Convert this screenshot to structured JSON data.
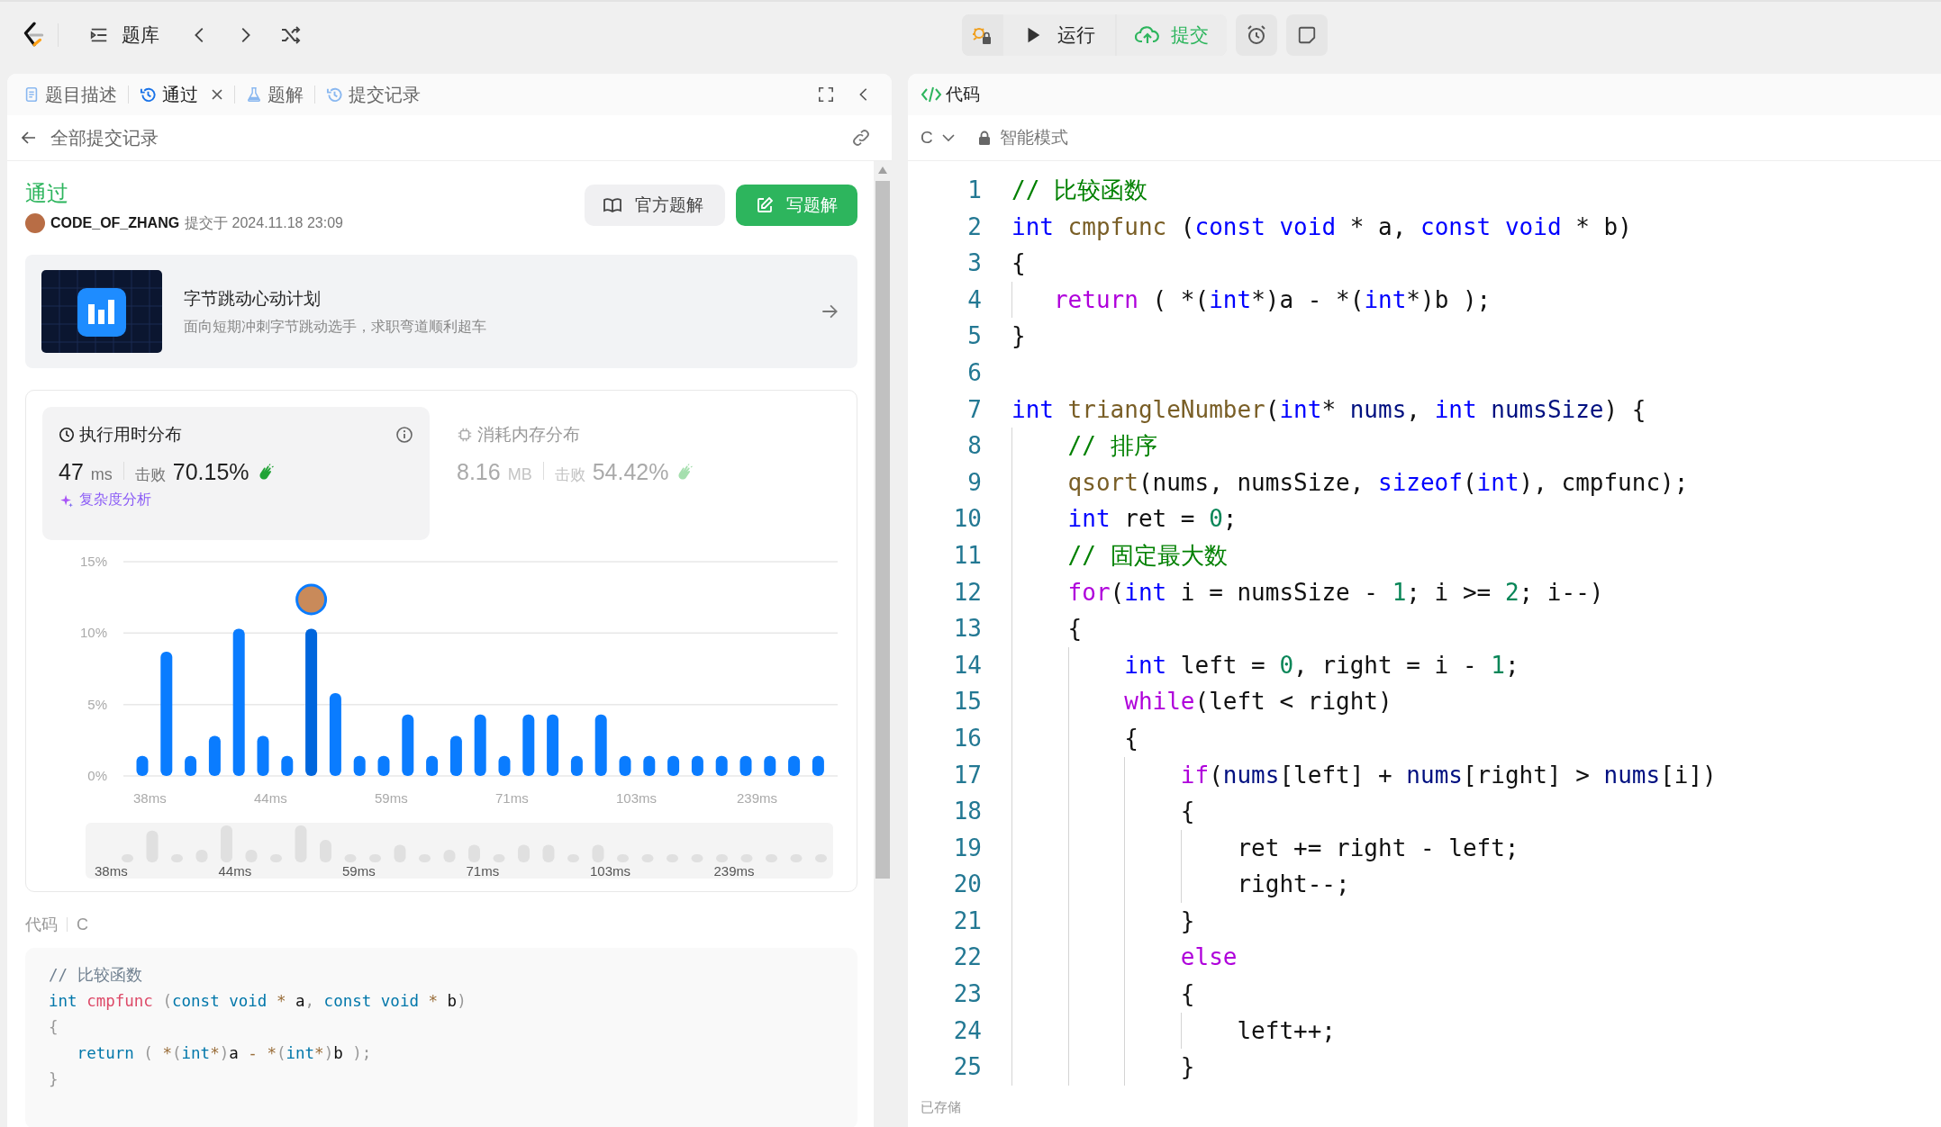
{
  "top_bar": {
    "problem_bank": "题库",
    "run": "运行",
    "submit": "提交"
  },
  "left_tabs": [
    {
      "label": "题目描述",
      "kind": "doc",
      "selected": false,
      "closable": false
    },
    {
      "label": "通过",
      "kind": "history",
      "selected": true,
      "closable": true
    },
    {
      "label": "题解",
      "kind": "flask",
      "selected": false,
      "closable": false
    },
    {
      "label": "提交记录",
      "kind": "history",
      "selected": false,
      "closable": false
    }
  ],
  "back": "全部提交记录",
  "submission": {
    "status": "通过",
    "user": "CODE_OF_ZHANG",
    "submitted_at": "提交于 2024.11.18 23:09",
    "buttons": [
      {
        "label": "官方题解",
        "kind": "secondary"
      },
      {
        "label": "写题解",
        "kind": "primary"
      }
    ]
  },
  "banner": {
    "title": "字节跳动心动计划",
    "subtitle": "面向短期冲刺字节跳动选手，求职弯道顺利超车"
  },
  "stats": [
    {
      "kind": "time",
      "title": "执行用时分布",
      "value": "47",
      "unit": "ms",
      "beat_label": "击败",
      "beat": "70.15%",
      "selected": true,
      "link": "复杂度分析"
    },
    {
      "kind": "memory",
      "title": "消耗内存分布",
      "value": "8.16",
      "unit": "MB",
      "beat_label": "击败",
      "beat": "54.42%",
      "selected": false
    }
  ],
  "chart_data": {
    "type": "bar",
    "categories": [
      "38ms",
      null,
      null,
      null,
      null,
      "44ms",
      null,
      null,
      null,
      null,
      "59ms",
      null,
      null,
      null,
      null,
      "71ms",
      null,
      null,
      null,
      null,
      "103ms",
      null,
      null,
      null,
      null,
      "239ms",
      null,
      null,
      null
    ],
    "values": [
      1.4,
      8.7,
      1.4,
      2.8,
      10.3,
      2.8,
      1.4,
      10.3,
      5.8,
      1.4,
      1.4,
      4.3,
      1.4,
      2.8,
      4.3,
      1.4,
      4.3,
      4.3,
      1.4,
      4.3,
      1.4,
      1.4,
      1.4,
      1.4,
      1.4,
      1.4,
      1.4,
      1.4,
      1.4
    ],
    "ylim": [
      0,
      15
    ],
    "yticks": [
      {
        "value": 0,
        "label": "0%"
      },
      {
        "value": 5,
        "label": "5%"
      },
      {
        "value": 10,
        "label": "10%"
      },
      {
        "value": 15,
        "label": "15%"
      }
    ]
  },
  "bar_states": [
    {
      "selected": false
    },
    {
      "selected": false
    },
    {
      "selected": false
    },
    {
      "selected": false
    },
    {
      "selected": false
    },
    {
      "selected": false
    },
    {
      "selected": false
    },
    {
      "selected": true
    },
    {
      "selected": false
    },
    {
      "selected": false
    },
    {
      "selected": false
    },
    {
      "selected": false
    },
    {
      "selected": false
    },
    {
      "selected": false
    },
    {
      "selected": false
    },
    {
      "selected": false
    },
    {
      "selected": false
    },
    {
      "selected": false
    },
    {
      "selected": false
    },
    {
      "selected": false
    },
    {
      "selected": false
    },
    {
      "selected": false
    },
    {
      "selected": false
    },
    {
      "selected": false
    },
    {
      "selected": false
    },
    {
      "selected": false
    },
    {
      "selected": false
    },
    {
      "selected": false
    },
    {
      "selected": false
    }
  ],
  "overview_labels": [
    "38ms",
    "44ms",
    "59ms",
    "71ms",
    "103ms",
    "239ms"
  ],
  "submitted_code": {
    "label": "代码",
    "language": "C",
    "lines": [
      {
        "tokens": [
          {
            "kind": "cm",
            "text": "// 比较函数"
          }
        ]
      },
      {
        "tokens": [
          {
            "kind": "kw",
            "text": "int"
          },
          {
            "kind": "fn",
            "text": " cmpfunc"
          },
          {
            "kind": "pu",
            "text": " ("
          },
          {
            "kind": "kw",
            "text": "const"
          },
          {
            "kind": "kw",
            "text": " void"
          },
          {
            "kind": "op",
            "text": " *"
          },
          {
            "kind": "p",
            "text": " a"
          },
          {
            "kind": "pu",
            "text": ","
          },
          {
            "kind": "kw",
            "text": " const"
          },
          {
            "kind": "kw",
            "text": " void"
          },
          {
            "kind": "op",
            "text": " *"
          },
          {
            "kind": "p",
            "text": " b"
          },
          {
            "kind": "pu",
            "text": ")"
          }
        ]
      },
      {
        "tokens": [
          {
            "kind": "pu",
            "text": "{"
          }
        ]
      },
      {
        "tokens": [
          {
            "kind": "kw",
            "text": "   return"
          },
          {
            "kind": "pu",
            "text": " ("
          },
          {
            "kind": "op",
            "text": " *"
          },
          {
            "kind": "pu",
            "text": "("
          },
          {
            "kind": "kw",
            "text": "int"
          },
          {
            "kind": "op",
            "text": "*"
          },
          {
            "kind": "pu",
            "text": ")"
          },
          {
            "kind": "p",
            "text": "a"
          },
          {
            "kind": "op",
            "text": " -"
          },
          {
            "kind": "op",
            "text": " *"
          },
          {
            "kind": "pu",
            "text": "("
          },
          {
            "kind": "kw",
            "text": "int"
          },
          {
            "kind": "op",
            "text": "*"
          },
          {
            "kind": "pu",
            "text": ")"
          },
          {
            "kind": "p",
            "text": "b"
          },
          {
            "kind": "pu",
            "text": " );"
          }
        ]
      },
      {
        "tokens": [
          {
            "kind": "pu",
            "text": "}"
          }
        ]
      }
    ]
  },
  "editor": {
    "title": "代码",
    "language": "C",
    "mode": "智能模式",
    "status": "已存储",
    "lines": [
      {
        "number": "1",
        "tokens": [
          {
            "kind": "cm",
            "text": "// 比较函数"
          }
        ]
      },
      {
        "number": "2",
        "tokens": [
          {
            "kind": "kw",
            "text": "int"
          },
          {
            "kind": "fn",
            "text": " cmpfunc"
          },
          {
            "kind": "p",
            "text": " ("
          },
          {
            "kind": "kw",
            "text": "const"
          },
          {
            "kind": "kw",
            "text": " void"
          },
          {
            "kind": "p",
            "text": " * a, "
          },
          {
            "kind": "kw",
            "text": "const"
          },
          {
            "kind": "kw",
            "text": " void"
          },
          {
            "kind": "p",
            "text": " * b)"
          }
        ]
      },
      {
        "number": "3",
        "tokens": [
          {
            "kind": "p",
            "text": "{"
          }
        ]
      },
      {
        "number": "4",
        "tokens": [
          {
            "kind": "ctl",
            "text": "   return"
          },
          {
            "kind": "p",
            "text": " ( *("
          },
          {
            "kind": "kw",
            "text": "int"
          },
          {
            "kind": "p",
            "text": "*)a - *("
          },
          {
            "kind": "kw",
            "text": "int"
          },
          {
            "kind": "p",
            "text": "*)b );"
          }
        ]
      },
      {
        "number": "5",
        "tokens": [
          {
            "kind": "p",
            "text": "}"
          }
        ]
      },
      {
        "number": "6"
      },
      {
        "number": "7",
        "tokens": [
          {
            "kind": "kw",
            "text": "int"
          },
          {
            "kind": "fn",
            "text": " triangleNumber"
          },
          {
            "kind": "p",
            "text": "("
          },
          {
            "kind": "kw",
            "text": "int"
          },
          {
            "kind": "p",
            "text": "* "
          },
          {
            "kind": "var",
            "text": "nums"
          },
          {
            "kind": "p",
            "text": ", "
          },
          {
            "kind": "kw",
            "text": "int"
          },
          {
            "kind": "var",
            "text": " numsSize"
          },
          {
            "kind": "p",
            "text": ") {"
          }
        ]
      },
      {
        "number": "8",
        "tokens": [
          {
            "kind": "cm",
            "text": "    // 排序"
          }
        ]
      },
      {
        "number": "9",
        "tokens": [
          {
            "kind": "fn",
            "text": "    qsort"
          },
          {
            "kind": "p",
            "text": "(nums, numsSize, "
          },
          {
            "kind": "kw",
            "text": "sizeof"
          },
          {
            "kind": "p",
            "text": "("
          },
          {
            "kind": "kw",
            "text": "int"
          },
          {
            "kind": "p",
            "text": "), cmpfunc);"
          }
        ]
      },
      {
        "number": "10",
        "tokens": [
          {
            "kind": "kw",
            "text": "    int"
          },
          {
            "kind": "p",
            "text": " ret = "
          },
          {
            "kind": "num",
            "text": "0"
          },
          {
            "kind": "p",
            "text": ";"
          }
        ]
      },
      {
        "number": "11",
        "tokens": [
          {
            "kind": "cm",
            "text": "    // 固定最大数"
          }
        ]
      },
      {
        "number": "12",
        "tokens": [
          {
            "kind": "ctl",
            "text": "    for"
          },
          {
            "kind": "p",
            "text": "("
          },
          {
            "kind": "kw",
            "text": "int"
          },
          {
            "kind": "p",
            "text": " i = numsSize - "
          },
          {
            "kind": "num",
            "text": "1"
          },
          {
            "kind": "p",
            "text": "; i >= "
          },
          {
            "kind": "num",
            "text": "2"
          },
          {
            "kind": "p",
            "text": "; i--)"
          }
        ]
      },
      {
        "number": "13",
        "tokens": [
          {
            "kind": "p",
            "text": "    {"
          }
        ]
      },
      {
        "number": "14",
        "tokens": [
          {
            "kind": "kw",
            "text": "        int"
          },
          {
            "kind": "p",
            "text": " left = "
          },
          {
            "kind": "num",
            "text": "0"
          },
          {
            "kind": "p",
            "text": ", right = i - "
          },
          {
            "kind": "num",
            "text": "1"
          },
          {
            "kind": "p",
            "text": ";"
          }
        ]
      },
      {
        "number": "15",
        "tokens": [
          {
            "kind": "ctl",
            "text": "        while"
          },
          {
            "kind": "p",
            "text": "(left < right)"
          }
        ]
      },
      {
        "number": "16",
        "tokens": [
          {
            "kind": "p",
            "text": "        {"
          }
        ]
      },
      {
        "number": "17",
        "tokens": [
          {
            "kind": "ctl",
            "text": "            if"
          },
          {
            "kind": "p",
            "text": "("
          },
          {
            "kind": "var",
            "text": "nums"
          },
          {
            "kind": "p",
            "text": "[left] + "
          },
          {
            "kind": "var",
            "text": "nums"
          },
          {
            "kind": "p",
            "text": "[right] > "
          },
          {
            "kind": "var",
            "text": "nums"
          },
          {
            "kind": "p",
            "text": "[i])"
          }
        ]
      },
      {
        "number": "18",
        "tokens": [
          {
            "kind": "p",
            "text": "            {"
          }
        ]
      },
      {
        "number": "19",
        "tokens": [
          {
            "kind": "p",
            "text": "                ret += right - left;"
          }
        ]
      },
      {
        "number": "20",
        "tokens": [
          {
            "kind": "p",
            "text": "                right--;"
          }
        ]
      },
      {
        "number": "21",
        "tokens": [
          {
            "kind": "p",
            "text": "            }"
          }
        ]
      },
      {
        "number": "22",
        "tokens": [
          {
            "kind": "ctl",
            "text": "            else"
          }
        ]
      },
      {
        "number": "23",
        "tokens": [
          {
            "kind": "p",
            "text": "            {"
          }
        ]
      },
      {
        "number": "24",
        "tokens": [
          {
            "kind": "p",
            "text": "                left++;"
          }
        ]
      },
      {
        "number": "25",
        "tokens": [
          {
            "kind": "p",
            "text": "            }"
          }
        ]
      }
    ]
  }
}
